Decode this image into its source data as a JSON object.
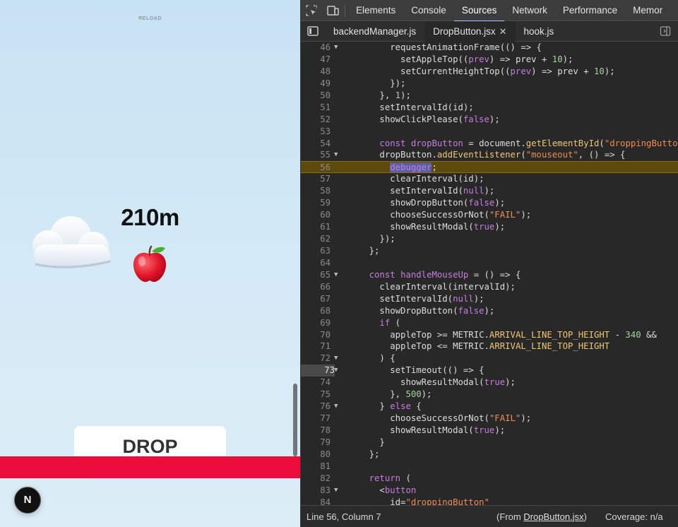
{
  "game": {
    "reload_label": "RELOAD",
    "height_readout": "210m",
    "cloud_emoji": "☁",
    "apple_emoji": "🍎",
    "drop_label": "DROP",
    "badge_letter": "N",
    "arrival_line_color": "#ec0c3c"
  },
  "devtools": {
    "main_tabs": [
      "Elements",
      "Console",
      "Sources",
      "Network",
      "Performance",
      "Memor"
    ],
    "active_main_tab": "Sources",
    "file_tabs": [
      "backendManager.js",
      "DropButton.jsx",
      "hook.js"
    ],
    "active_file_tab": "DropButton.jsx",
    "paused_line": 56,
    "current_gutter_line": 73,
    "status": {
      "cursor": "Line 56, Column 7",
      "from_prefix": "(From ",
      "from_file": "DropButton.jsx",
      "from_suffix": ")",
      "coverage": "Coverage: n/a"
    },
    "code_lines": [
      {
        "n": "46",
        "fold": true,
        "t": "        requestAnimationFrame(() => {"
      },
      {
        "n": "47",
        "fold": false,
        "t": "          setAppleTop((prev) => prev + 10);"
      },
      {
        "n": "48",
        "fold": false,
        "t": "          setCurrentHeightTop((prev) => prev + 10);"
      },
      {
        "n": "49",
        "fold": false,
        "t": "        });"
      },
      {
        "n": "50",
        "fold": false,
        "t": "      }, 1);"
      },
      {
        "n": "51",
        "fold": false,
        "t": "      setIntervalId(id);"
      },
      {
        "n": "52",
        "fold": false,
        "t": "      showClickPlease(false);"
      },
      {
        "n": "53",
        "fold": false,
        "t": ""
      },
      {
        "n": "54",
        "fold": false,
        "t": "      const dropButton = document.getElementById(\"droppingButton\");"
      },
      {
        "n": "55",
        "fold": true,
        "t": "      dropButton.addEventListener(\"mouseout\", () => {"
      },
      {
        "n": "56",
        "fold": false,
        "t": "        debugger;"
      },
      {
        "n": "57",
        "fold": false,
        "t": "        clearInterval(id);"
      },
      {
        "n": "58",
        "fold": false,
        "t": "        setIntervalId(null);"
      },
      {
        "n": "59",
        "fold": false,
        "t": "        showDropButton(false);"
      },
      {
        "n": "60",
        "fold": false,
        "t": "        chooseSuccessOrNot(\"FAIL\");"
      },
      {
        "n": "61",
        "fold": false,
        "t": "        showResultModal(true);"
      },
      {
        "n": "62",
        "fold": false,
        "t": "      });"
      },
      {
        "n": "63",
        "fold": false,
        "t": "    };"
      },
      {
        "n": "64",
        "fold": false,
        "t": ""
      },
      {
        "n": "65",
        "fold": true,
        "t": "    const handleMouseUp = () => {"
      },
      {
        "n": "66",
        "fold": false,
        "t": "      clearInterval(intervalId);"
      },
      {
        "n": "67",
        "fold": false,
        "t": "      setIntervalId(null);"
      },
      {
        "n": "68",
        "fold": false,
        "t": "      showDropButton(false);"
      },
      {
        "n": "69",
        "fold": false,
        "t": "      if ("
      },
      {
        "n": "70",
        "fold": false,
        "t": "        appleTop >= METRIC.ARRIVAL_LINE_TOP_HEIGHT - 340 &&"
      },
      {
        "n": "71",
        "fold": false,
        "t": "        appleTop <= METRIC.ARRIVAL_LINE_TOP_HEIGHT"
      },
      {
        "n": "72",
        "fold": true,
        "t": "      ) {"
      },
      {
        "n": "73",
        "fold": true,
        "t": "        setTimeout(() => {"
      },
      {
        "n": "74",
        "fold": false,
        "t": "          showResultModal(true);"
      },
      {
        "n": "75",
        "fold": false,
        "t": "        }, 500);"
      },
      {
        "n": "76",
        "fold": true,
        "t": "      } else {"
      },
      {
        "n": "77",
        "fold": false,
        "t": "        chooseSuccessOrNot(\"FAIL\");"
      },
      {
        "n": "78",
        "fold": false,
        "t": "        showResultModal(true);"
      },
      {
        "n": "79",
        "fold": false,
        "t": "      }"
      },
      {
        "n": "80",
        "fold": false,
        "t": "    };"
      },
      {
        "n": "81",
        "fold": false,
        "t": ""
      },
      {
        "n": "82",
        "fold": false,
        "t": "    return ("
      },
      {
        "n": "83",
        "fold": true,
        "t": "      <button"
      },
      {
        "n": "84",
        "fold": false,
        "t": "        id=\"droppingButton\""
      }
    ]
  }
}
